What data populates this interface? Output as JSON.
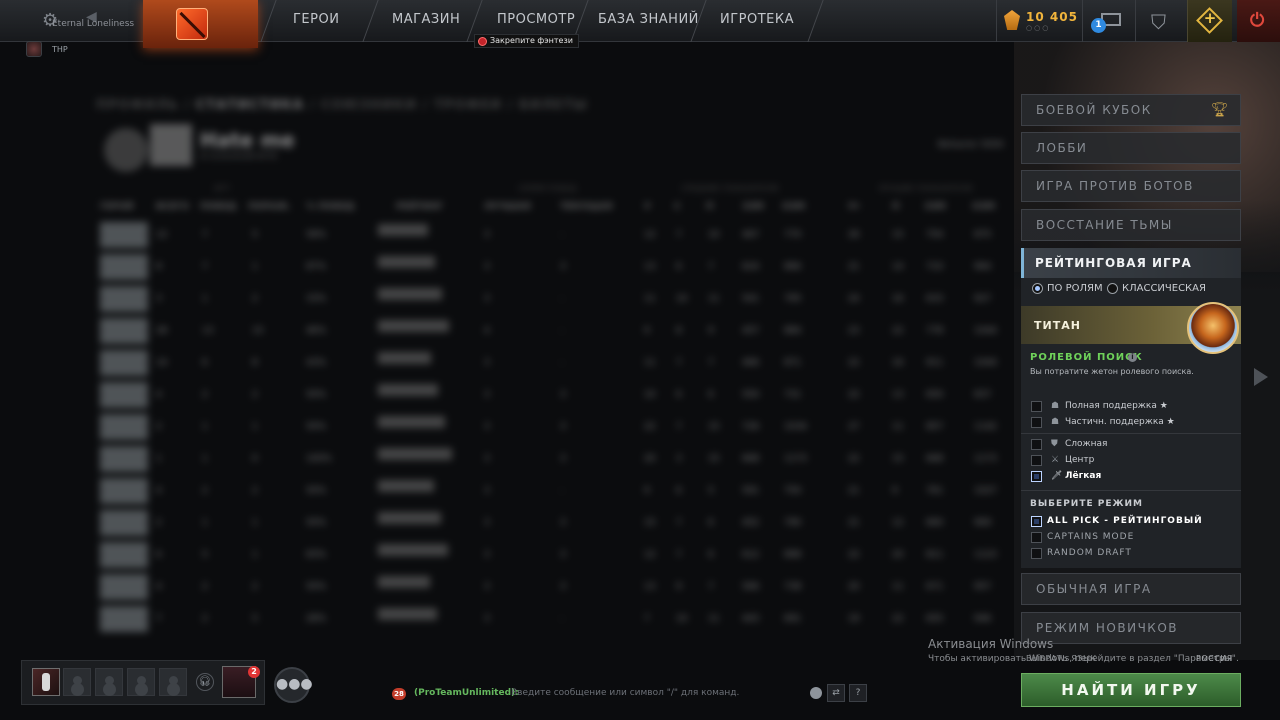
{
  "profile": {
    "name": "Eternal Loneliness",
    "sub_name": "THP"
  },
  "nav": {
    "items": [
      {
        "label": "ГЕРОИ"
      },
      {
        "label": "МАГАЗИН"
      },
      {
        "label": "ПРОСМОТР"
      },
      {
        "label": "БАЗА ЗНАНИЙ"
      },
      {
        "label": "ИГРОТЕКА"
      }
    ]
  },
  "fantasy_banner": "Закрепите фэнтези",
  "shards": "10 405",
  "shards_sub": "○○○",
  "mail_badge": "1",
  "dashboard": {
    "breadcrumbs": [
      "ПРОФИЛЬ",
      "СТАТИСТИКА",
      "СОЮЗНИКИ",
      "ТРОФЕИ",
      "БИЛЕТЫ"
    ],
    "player_name": "Hate me",
    "player_sub": "В СЕЗОННОЙ ИГРЕ",
    "behavior": "Behavior 5000",
    "groups": [
      "ИГР",
      "СЕРИЯ ПОБЕД",
      "СРЕДНИЕ ПОКАЗАТЕЛИ",
      "ЛУЧШИЕ ПОКАЗАТЕЛИ"
    ],
    "headers": [
      "ГЕРОЙ",
      "ВСЕГО",
      "ПОБЕД",
      "ПОРАЖ.",
      "% ПОБЕД",
      "РЕЙТИНГ",
      "ЛУЧШАЯ",
      "ТЕКУЩАЯ",
      "У",
      "С",
      "П",
      "ЗЗМ",
      "ОЗМ",
      "У▾",
      "П",
      "ЗЗМ",
      "ОЗМ"
    ],
    "rows": [
      [
        "12",
        "7",
        "5",
        "58%",
        "3",
        "-",
        "12",
        "7",
        "10",
        "467",
        "770",
        "26",
        "15",
        "754",
        "875"
      ],
      [
        "8",
        "7",
        "1",
        "87%",
        "3",
        "3",
        "13",
        "6",
        "7",
        "624",
        "866",
        "21",
        "14",
        "710",
        "964"
      ],
      [
        "3",
        "1",
        "2",
        "33%",
        "3",
        "-",
        "11",
        "10",
        "11",
        "541",
        "795",
        "24",
        "16",
        "633",
        "927"
      ],
      [
        "28",
        "13",
        "15",
        "46%",
        "4",
        "-",
        "9",
        "8",
        "9",
        "457",
        "884",
        "23",
        "22",
        "778",
        "1044"
      ],
      [
        "14",
        "6",
        "8",
        "43%",
        "3",
        "-",
        "11",
        "7",
        "7",
        "466",
        "871",
        "22",
        "16",
        "911",
        "1044"
      ],
      [
        "4",
        "2",
        "2",
        "50%",
        "3",
        "3",
        "10",
        "6",
        "6",
        "550",
        "731",
        "22",
        "13",
        "650",
        "837"
      ],
      [
        "2",
        "1",
        "1",
        "50%",
        "3",
        "3",
        "22",
        "7",
        "15",
        "726",
        "1034",
        "27",
        "11",
        "857",
        "1142"
      ],
      [
        "1",
        "1",
        "0",
        "100%",
        "3",
        "3",
        "20",
        "3",
        "15",
        "668",
        "1173",
        "22",
        "15",
        "668",
        "1173"
      ],
      [
        "4",
        "2",
        "2",
        "50%",
        "3",
        "-",
        "9",
        "6",
        "5",
        "591",
        "750",
        "21",
        "9",
        "761",
        "1027"
      ],
      [
        "2",
        "1",
        "1",
        "50%",
        "3",
        "3",
        "15",
        "7",
        "6",
        "452",
        "790",
        "21",
        "12",
        "660",
        "969"
      ],
      [
        "6",
        "5",
        "1",
        "83%",
        "3",
        "3",
        "12",
        "7",
        "6",
        "612",
        "898",
        "22",
        "20",
        "811",
        "1123"
      ],
      [
        "4",
        "2",
        "2",
        "50%",
        "3",
        "3",
        "13",
        "9",
        "7",
        "566",
        "738",
        "20",
        "11",
        "671",
        "957"
      ],
      [
        "7",
        "2",
        "5",
        "28%",
        "3",
        "-",
        "7",
        "10",
        "11",
        "443",
        "691",
        "19",
        "22",
        "655",
        "946"
      ]
    ]
  },
  "right_panel": {
    "modes_top": [
      {
        "label": "БОЕВОЙ КУБОК",
        "icon": "trophy-icon"
      },
      {
        "label": "ЛОББИ"
      },
      {
        "label": "ИГРА ПРОТИВ БОТОВ"
      },
      {
        "label": "ВОССТАНИЕ ТЬМЫ"
      }
    ],
    "ranked": {
      "title": "РЕЙТИНГОВАЯ ИГРА",
      "radio_roles": "ПО РОЛЯМ",
      "radio_classic": "КЛАССИЧЕСКАЯ",
      "rank_name": "ТИТАН",
      "role_search_title": "РОЛЕВОЙ ПОИСК",
      "role_search_sub": "Вы потратите жетон ролевого поиска.",
      "roles": [
        {
          "label": "Полная поддержка ★",
          "checked": false
        },
        {
          "label": "Частичн. поддержка ★",
          "checked": false
        },
        {
          "label": "Сложная",
          "checked": false
        },
        {
          "label": "Центр",
          "checked": false
        },
        {
          "label": "Лёгкая",
          "checked": true
        }
      ],
      "mode_title": "ВЫБЕРИТЕ РЕЖИМ",
      "game_modes": [
        {
          "label": "ALL PICK - РЕЙТИНГОВЫЙ",
          "checked": true
        },
        {
          "label": "CAPTAINS MODE",
          "checked": false
        },
        {
          "label": "RANDOM DRAFT",
          "checked": false
        }
      ]
    },
    "modes_bottom": [
      {
        "label": "ОБЫЧНАЯ ИГРА"
      },
      {
        "label": "РЕЖИМ НОВИЧКОВ"
      }
    ],
    "language_label": "ВЫБРАТЬ ЯЗЫК",
    "language_value": "РОССИЯ",
    "find_button": "НАЙТИ ИГРУ"
  },
  "windows_activation": {
    "title": "Активация Windows",
    "sub": "Чтобы активировать Windows, перейдите в раздел \"Параметры\"."
  },
  "bottom": {
    "invite_badge": "2",
    "chat_unread": "28",
    "chat_channel": "(ProTeamUnlimited):",
    "chat_placeholder": "Введите сообщение или символ \"/\" для команд.",
    "help_label": "?"
  },
  "colors": {
    "accent_green": "#6fd25a",
    "find_button": "#3d7a3a",
    "shards": "#f0b43c",
    "power": "#e0483c"
  }
}
